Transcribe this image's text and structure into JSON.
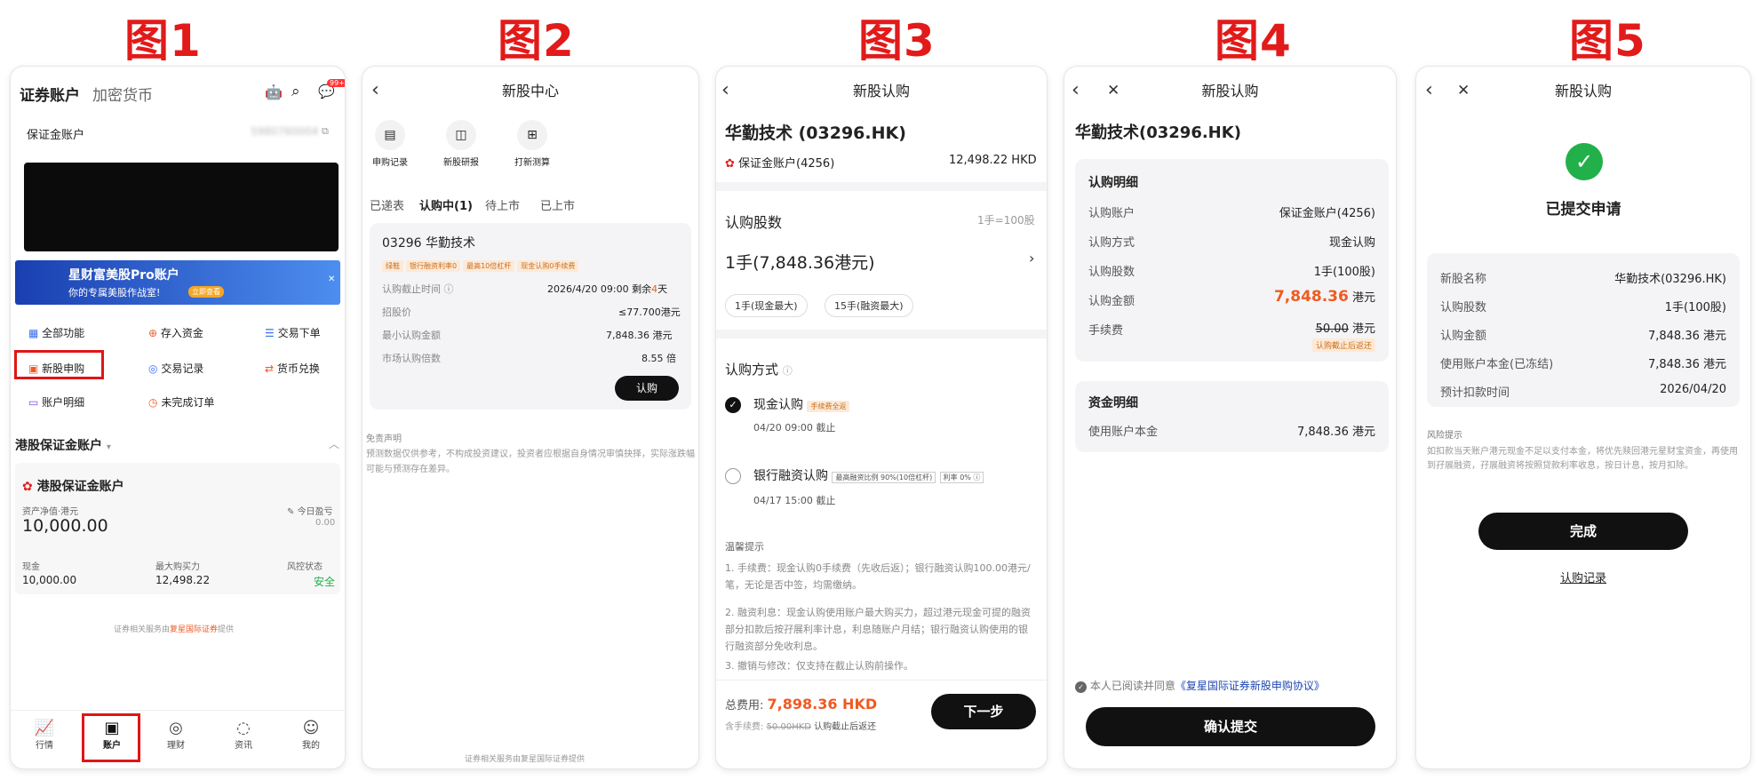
{
  "labels": {
    "p1": "图1",
    "p2": "图2",
    "p3": "图3",
    "p4": "图4",
    "p5": "图5"
  },
  "s1": {
    "tab_active": "证券账户",
    "tab_other": "加密货币",
    "badge": "99+",
    "margin_account": "保证金账户",
    "account_no": "5980760004",
    "banner_title": "星财富美股Pro账户",
    "banner_sub": "你的专属美股作战室!",
    "banner_btn": "立即查看",
    "grid": [
      "全部功能",
      "存入资金",
      "交易下单",
      "新股申购",
      "交易记录",
      "货币兑换",
      "账户明细",
      "未完成订单"
    ],
    "section": "港股保证金账户",
    "card_title": "港股保证金账户",
    "nav_label": "资产净值·港元",
    "nav": "10,000.00",
    "pnl_label": "今日盈亏",
    "pnl": "0.00",
    "cash_label": "现金",
    "cash": "10,000.00",
    "power_label": "最大购买力",
    "power": "12,498.22",
    "risk_label": "风控状态",
    "risk": "安全",
    "footer": "证券相关服务由",
    "footer_brand": "复星国际证券",
    "footer_end": "提供",
    "nav_items": [
      "行情",
      "账户",
      "理财",
      "资讯",
      "我的"
    ]
  },
  "s2": {
    "title": "新股中心",
    "actions": [
      "申购记录",
      "新股研报",
      "打新测算"
    ],
    "tabs": [
      "已递表",
      "认购中(1)",
      "待上市",
      "已上市"
    ],
    "stock": "03296 华勤技术",
    "tags": [
      "绿鞋",
      "银行融资利率0",
      "最高10倍杠杆",
      "现金认购0手续费"
    ],
    "deadline_label": "认购截止时间",
    "deadline": "2026/4/20 09:00 剩余",
    "deadline_days": "4",
    "deadline_unit": "天",
    "price_label": "招股价",
    "price": "≤77.700港元",
    "min_label": "最小认购金额",
    "min": "7,848.36 港元",
    "mult_label": "市场认购倍数",
    "mult": "8.55 倍",
    "btn": "认购",
    "disclaimer_title": "免责声明",
    "disclaimer": "预测数据仅供参考，不构成投资建议，投资者应根据自身情况审慎抉择，实际涨跌幅可能与预测存在差异。",
    "footer": "证券相关服务由复星国际证券提供"
  },
  "s3": {
    "title": "新股认购",
    "stock": "华勤技术 (03296.HK)",
    "account": "保证金账户(4256)",
    "balance": "12,498.22 HKD",
    "shares_label": "认购股数",
    "lot": "1手=100股",
    "shares": "1手(7,848.36港元)",
    "chip1": "1手(现金最大)",
    "chip2": "15手(融资最大)",
    "method_label": "认购方式",
    "cash_opt": "现金认购",
    "cash_tag": "手续费全返",
    "cash_deadline": "04/20 09:00 截止",
    "fin_opt": "银行融资认购",
    "fin_tag1": "最高融资比例 90%(10倍杠杆)",
    "fin_tag2": "利率 0%",
    "fin_deadline": "04/17 15:00 截止",
    "tips_title": "温馨提示",
    "tips": [
      "1.  手续费：现金认购0手续费（先收后返）；银行融资认购100.00港元/笔，无论是否中签，均需缴纳。",
      "2.  融资利息：现金认购使用账户最大购买力，超过港元现金可提的融资部分扣款后按孖展利率计息，利息随账户月结；银行融资认购使用的银行融资部分免收利息。",
      "3.  撤销与修改：仅支持在截止认购前操作。"
    ],
    "total_label": "总费用:",
    "total": "7,898.36 HKD",
    "fee_label": "含手续费:",
    "fee": "50.00HKD",
    "fee_note": "认购截止后返还",
    "next": "下一步"
  },
  "s4": {
    "title": "新股认购",
    "stock": "华勤技术(03296.HK)",
    "detail_title": "认购明细",
    "rows": [
      {
        "k": "认购账户",
        "v": "保证金账户(4256)"
      },
      {
        "k": "认购方式",
        "v": "现金认购"
      },
      {
        "k": "认购股数",
        "v": "1手(100股)"
      }
    ],
    "amount_label": "认购金额",
    "amount": "7,848.36",
    "unit": "港元",
    "fee_label": "手续费",
    "fee": "50.00",
    "fee_note": "认购截止后返还",
    "fund_title": "资金明细",
    "fund_label": "使用账户本金",
    "fund": "7,848.36 港元",
    "agree": "本人已阅读并同意",
    "agree_link": "《复星国际证券新股申购协议》",
    "submit": "确认提交"
  },
  "s5": {
    "title": "新股认购",
    "status": "已提交申请",
    "rows": [
      {
        "k": "新股名称",
        "v": "华勤技术(03296.HK)"
      },
      {
        "k": "认购股数",
        "v": "1手(100股)"
      },
      {
        "k": "认购金额",
        "v": "7,848.36 港元"
      },
      {
        "k": "使用账户本金(已冻结)",
        "v": "7,848.36 港元"
      },
      {
        "k": "预计扣款时间",
        "v": "2026/04/20"
      }
    ],
    "risk_title": "风险提示",
    "risk": "如扣款当天账户港元现金不足以支付本金，将优先赎回港元星财宝资金，再使用到孖展融资，孖展融资将按照贷款利率收息，按日计息，按月扣除。",
    "done": "完成",
    "record": "认购记录"
  },
  "colors": {
    "accent": "#f05a22",
    "red_label": "#e21a1a",
    "black": "#111111",
    "green": "#22b04b",
    "link": "#1e46b4"
  }
}
